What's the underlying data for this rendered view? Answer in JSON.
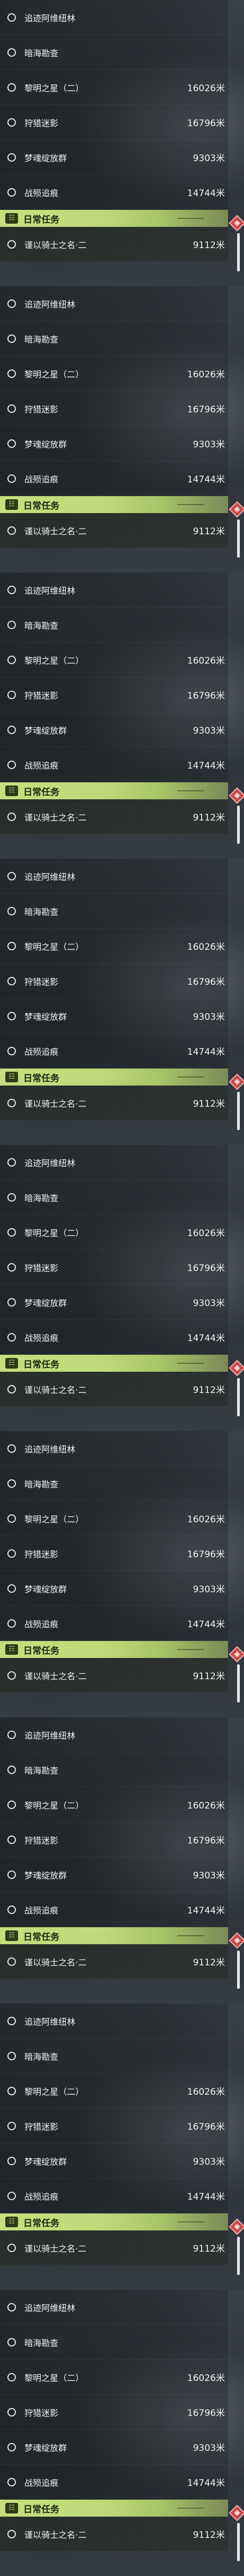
{
  "track_list": {
    "items": [
      {
        "name": "追迹阿维纽林",
        "distance": ""
      },
      {
        "name": "暗海勘查",
        "distance": ""
      },
      {
        "name": "黎明之星（二）",
        "distance": "16026米"
      },
      {
        "name": "狩猎迷影",
        "distance": "16796米"
      },
      {
        "name": "梦魂绽放群",
        "distance": "9303米"
      },
      {
        "name": "战殒追痕",
        "distance": "14744米"
      }
    ]
  },
  "daily_section": {
    "title": "日常任务",
    "icon": "daily-task-icon",
    "items": [
      {
        "name": "谨以骑士之名·二",
        "distance": "9112米"
      }
    ]
  },
  "colors": {
    "header_green": "#c6de7e",
    "badge_red": "#c94a4a",
    "row_text": "#f2f2f2"
  }
}
